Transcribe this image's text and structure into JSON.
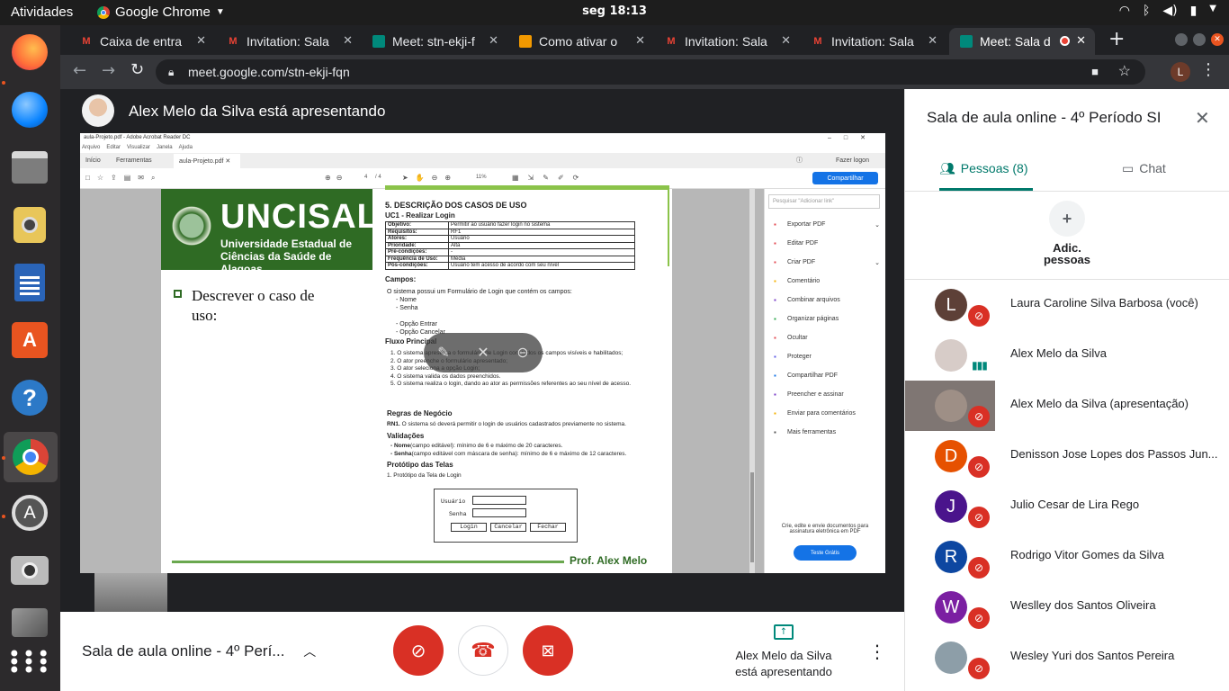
{
  "system": {
    "activities": "Atividades",
    "app_name": "Google Chrome",
    "clock": "seg 18:13"
  },
  "dock": {
    "icons": [
      "firefox-icon",
      "thunderbird-icon",
      "files-icon",
      "rhythmbox-icon",
      "writer-icon",
      "software-icon",
      "help-icon",
      "chrome-icon",
      "updater-icon",
      "camera-icon",
      "settings-icon",
      "apps-grid-icon"
    ]
  },
  "browser": {
    "tabs": [
      {
        "label": "Caixa de entra",
        "icon": "gmail"
      },
      {
        "label": "Invitation: Sala",
        "icon": "gmail"
      },
      {
        "label": "Meet: stn-ekji-f",
        "icon": "meet"
      },
      {
        "label": "Como ativar o",
        "icon": "doc"
      },
      {
        "label": "Invitation: Sala",
        "icon": "gmail"
      },
      {
        "label": "Invitation: Sala",
        "icon": "gmail"
      },
      {
        "label": "Meet: Sala d",
        "icon": "meet"
      }
    ],
    "url": "meet.google.com/stn-ekji-fqn",
    "profile_initial": "L"
  },
  "presentation": {
    "banner": "Alex Melo da Silva está apresentando",
    "pdf": {
      "window_title": "aula-Projeto.pdf - Adobe Acrobat Reader DC",
      "menu": [
        "Arquivo",
        "Editar",
        "Visualizar",
        "Janela",
        "Ajuda"
      ],
      "tabs": [
        "Início",
        "Ferramentas",
        "aula-Projeto.pdf"
      ],
      "login_label": "Fazer logon",
      "share_label": "Compartilhar",
      "page": "4",
      "page_total": "/ 4",
      "zoom": "11%",
      "logo_name": "UNCISAL",
      "logo_sub1": "Universidade Estadual de",
      "logo_sub2": "Ciências da Saúde de Alagoas",
      "bullet": "Descrever o caso de uso:",
      "h_main": "5. DESCRIÇÃO DOS CASOS DE USO",
      "uc": "UC1 - Realizar Login",
      "table": [
        [
          "Objetivo:",
          "Permitir ao usuário fazer login no sistema"
        ],
        [
          "Requisitos:",
          "RF1"
        ],
        [
          "Atores:",
          "Usuário"
        ],
        [
          "Prioridade:",
          "Alta"
        ],
        [
          "Pré-condições:",
          "-"
        ],
        [
          "Frequência de Uso:",
          "Média"
        ],
        [
          "Pós-condições:",
          "Usuário tem acesso de acordo com seu nível"
        ]
      ],
      "campos_h": "Campos:",
      "campos": [
        "O sistema possui um Formulário de Login que contém os campos:",
        "- Nome",
        "- Senha",
        "",
        "- Opção Entrar",
        "- Opção Cancelar"
      ],
      "fluxo_h": "Fluxo Principal",
      "fluxo": [
        "1. O sistema apresenta o formulário de Login com todos os campos visíveis e habilitados;",
        "2. O ator preenche o formulário apresentado;",
        "3. O ator seleciona a opção Login;",
        "4. O sistema valida os dados preenchidos.",
        "5. O sistema realiza o login, dando ao ator as permissões referentes ao seu nível de acesso."
      ],
      "regras_h": "Regras de Negócio",
      "rn1_label": "RN1.",
      "rn1": "O sistema só deverá permitir o login de usuários cadastrados previamente no sistema.",
      "valid_h": "Validações",
      "valid_nome_label": "- Nome",
      "valid_nome": "(campo editável): mínimo de 6 e máximo de 20 caracteres.",
      "valid_senha_label": "- Senha",
      "valid_senha": "(campo editável com máscara de senha): mínimo de 6 e máximo de 12 caracteres.",
      "prot_h": "Protótipo das Telas",
      "prot_item": "1. Protótipo da Tela de Login",
      "mock_user": "Usuário",
      "mock_pass": "Senha",
      "mock_btns": [
        "Login",
        "Cancelar",
        "Fechar"
      ],
      "footer": "Prof. Alex Melo",
      "search_placeholder": "Pesquisar \"Adicionar link\"",
      "side_tools": [
        "Exportar PDF",
        "Editar PDF",
        "Criar PDF",
        "Comentário",
        "Combinar arquivos",
        "Organizar páginas",
        "Ocultar",
        "Proteger",
        "Compartilhar PDF",
        "Preencher e assinar",
        "Enviar para comentários",
        "Mais ferramentas"
      ],
      "promo": "Crie, edite e envie documentos para assinatura eletrônica em PDF",
      "promo_btn": "Teste Grátis"
    }
  },
  "bottom": {
    "meeting_title": "Sala de aula online - 4º Perí...",
    "presenter_line1": "Alex Melo da Silva",
    "presenter_line2": "está apresentando"
  },
  "panel": {
    "title": "Sala de aula online - 4º Período SI",
    "tab_people": "Pessoas (8)",
    "tab_chat": "Chat",
    "add_label_1": "Adic.",
    "add_label_2": "pessoas",
    "people": [
      {
        "name": "Laura Caroline Silva Barbosa (você)",
        "initial": "L",
        "color": "#5d4037",
        "muted": true
      },
      {
        "name": "Alex Melo da Silva",
        "initial": "",
        "color": "#d7ccc8",
        "muted": false
      },
      {
        "name": "Alex Melo da Silva (apresentação)",
        "initial": "",
        "color": "#9e8f86",
        "muted": true
      },
      {
        "name": "Denisson Jose Lopes dos Passos Jun...",
        "initial": "D",
        "color": "#e65100",
        "muted": true
      },
      {
        "name": "Julio Cesar de Lira Rego",
        "initial": "J",
        "color": "#4a148c",
        "muted": true
      },
      {
        "name": "Rodrigo Vitor Gomes da Silva",
        "initial": "R",
        "color": "#0d47a1",
        "muted": true
      },
      {
        "name": "Weslley dos Santos Oliveira",
        "initial": "W",
        "color": "#7b1fa2",
        "muted": true
      },
      {
        "name": "Wesley Yuri dos Santos Pereira",
        "initial": "",
        "color": "#8d9ea8",
        "muted": true
      }
    ]
  },
  "colors": {
    "meet_red": "#d93025",
    "meet_green": "#00897b",
    "accent_blue": "#1a73e8"
  }
}
